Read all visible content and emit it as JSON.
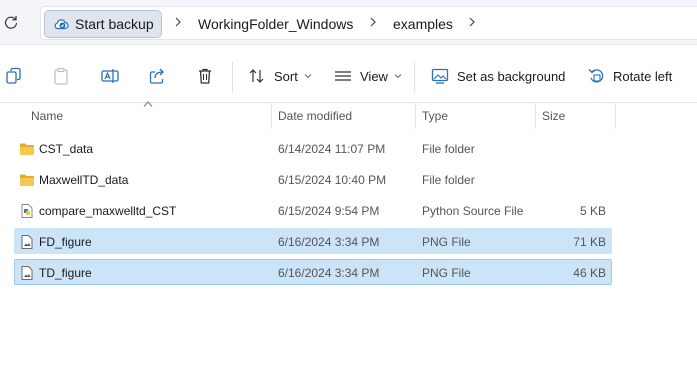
{
  "address_bar": {
    "root_chip_label": "Start backup",
    "breadcrumbs": [
      {
        "label": "WorkingFolder_Windows"
      },
      {
        "label": "examples"
      }
    ]
  },
  "command_bar": {
    "sort_label": "Sort",
    "view_label": "View",
    "set_background_label": "Set as background",
    "rotate_left_label": "Rotate left"
  },
  "columns": {
    "name": "Name",
    "date_modified": "Date modified",
    "type": "Type",
    "size": "Size"
  },
  "files": [
    {
      "name": "CST_data",
      "date": "6/14/2024 11:07 PM",
      "type": "File folder",
      "size": "",
      "icon": "folder-icon",
      "selected": false
    },
    {
      "name": "MaxwellTD_data",
      "date": "6/15/2024 10:40 PM",
      "type": "File folder",
      "size": "",
      "icon": "folder-icon",
      "selected": false
    },
    {
      "name": "compare_maxwelltd_CST",
      "date": "6/15/2024 9:54 PM",
      "type": "Python Source File",
      "size": "5 KB",
      "icon": "python-file-icon",
      "selected": false
    },
    {
      "name": "FD_figure",
      "date": "6/16/2024 3:34 PM",
      "type": "PNG File",
      "size": "71 KB",
      "icon": "png-file-icon",
      "selected": true
    },
    {
      "name": "TD_figure",
      "date": "6/16/2024 3:34 PM",
      "type": "PNG File",
      "size": "46 KB",
      "icon": "png-file-icon",
      "selected": true,
      "focused": true
    }
  ],
  "colors": {
    "selection": "#cce4f7",
    "focus_border": "#99c9ef",
    "folder": "#f4c04a",
    "accent": "#2a6fb5"
  }
}
